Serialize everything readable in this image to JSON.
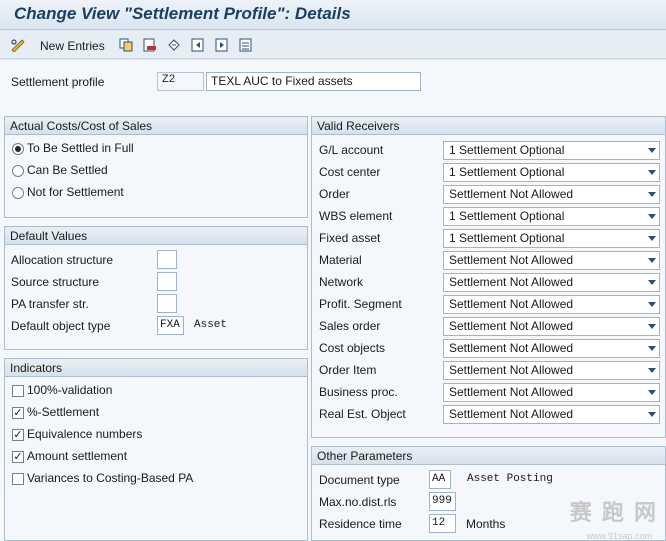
{
  "window": {
    "title": "Change View \"Settlement Profile\": Details"
  },
  "toolbar": {
    "new_entries_label": "New Entries",
    "icons": [
      "edit-glasses-icon",
      "copy-icon",
      "delete-icon",
      "undo-icon",
      "prev-entry-icon",
      "next-entry-icon",
      "select-all-icon"
    ]
  },
  "header": {
    "settlement_profile_label": "Settlement profile",
    "settlement_profile_code": "Z2",
    "settlement_profile_desc": "TEXL AUC to Fixed assets"
  },
  "actual_costs": {
    "title": "Actual Costs/Cost of Sales",
    "options": [
      {
        "label": "To Be Settled in Full",
        "selected": true
      },
      {
        "label": "Can Be Settled",
        "selected": false
      },
      {
        "label": "Not for Settlement",
        "selected": false
      }
    ]
  },
  "default_values": {
    "title": "Default Values",
    "rows": [
      {
        "label": "Allocation structure",
        "value": "",
        "desc": ""
      },
      {
        "label": "Source structure",
        "value": "",
        "desc": ""
      },
      {
        "label": "PA transfer str.",
        "value": "",
        "desc": ""
      },
      {
        "label": "Default object type",
        "value": "FXA",
        "desc": "Asset"
      }
    ]
  },
  "indicators": {
    "title": "Indicators",
    "items": [
      {
        "label": "100%-validation",
        "checked": false
      },
      {
        "label": "%-Settlement",
        "checked": true
      },
      {
        "label": "Equivalence numbers",
        "checked": true
      },
      {
        "label": "Amount settlement",
        "checked": true
      },
      {
        "label": "Variances to Costing-Based PA",
        "checked": false
      }
    ]
  },
  "valid_receivers": {
    "title": "Valid Receivers",
    "rows": [
      {
        "label": "G/L account",
        "value": "1 Settlement Optional"
      },
      {
        "label": "Cost center",
        "value": "1 Settlement Optional"
      },
      {
        "label": "Order",
        "value": "Settlement Not Allowed"
      },
      {
        "label": "WBS element",
        "value": "1 Settlement Optional"
      },
      {
        "label": "Fixed asset",
        "value": "1 Settlement Optional"
      },
      {
        "label": "Material",
        "value": "Settlement Not Allowed"
      },
      {
        "label": "Network",
        "value": "Settlement Not Allowed"
      },
      {
        "label": "Profit. Segment",
        "value": "Settlement Not Allowed"
      },
      {
        "label": "Sales order",
        "value": "Settlement Not Allowed"
      },
      {
        "label": "Cost objects",
        "value": "Settlement Not Allowed"
      },
      {
        "label": "Order Item",
        "value": "Settlement Not Allowed"
      },
      {
        "label": "Business proc.",
        "value": "Settlement Not Allowed"
      },
      {
        "label": "Real Est. Object",
        "value": "Settlement Not Allowed"
      }
    ]
  },
  "other_parameters": {
    "title": "Other Parameters",
    "document_type_label": "Document type",
    "document_type_value": "AA",
    "document_type_desc": "Asset Posting",
    "max_dist_label": "Max.no.dist.rls",
    "max_dist_value": "999",
    "residence_label": "Residence time",
    "residence_value": "12",
    "residence_unit": "Months"
  },
  "watermark": {
    "text": "赛 跑 网",
    "url": "www.91sap.com"
  },
  "colors": {
    "title": "#1b3e63",
    "accent": "#2c4f78",
    "background": "#f4f7fb",
    "border": "#aebdcd"
  }
}
